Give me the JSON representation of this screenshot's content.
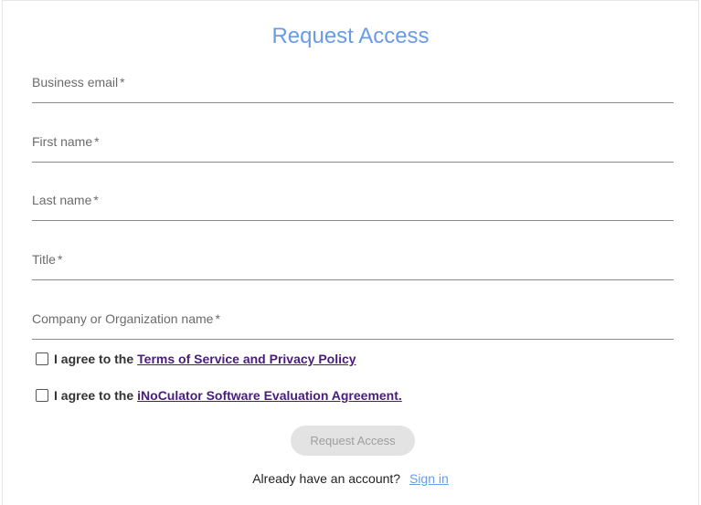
{
  "form": {
    "title": "Request Access",
    "fields": [
      {
        "label": "Business email",
        "required": "*"
      },
      {
        "label": "First name",
        "required": "*"
      },
      {
        "label": "Last name",
        "required": "*"
      },
      {
        "label": "Title",
        "required": "*"
      },
      {
        "label": "Company or Organization name",
        "required": "*"
      }
    ],
    "agreements": [
      {
        "prefix": "I agree to the",
        "link": "Terms of Service and Privacy Policy"
      },
      {
        "prefix": "I agree to the",
        "link": "iNoCulator Software Evaluation Agreement."
      }
    ],
    "submit_label": "Request Access",
    "signin_prompt": "Already have an account?",
    "signin_link": "Sign in"
  },
  "colors": {
    "title": "#6a9be6",
    "link": "#4a1c7a",
    "signin": "#6a9be6",
    "button_bg": "#e3e3e3"
  }
}
